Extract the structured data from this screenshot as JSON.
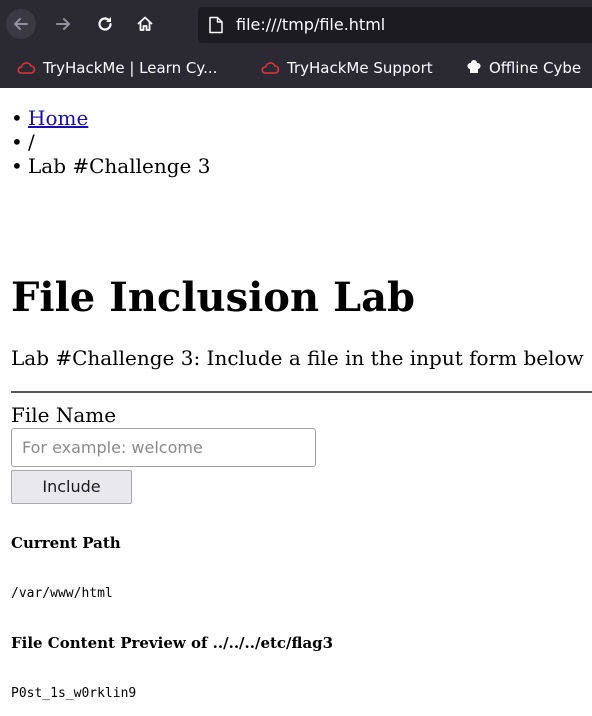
{
  "browser": {
    "url": "file:///tmp/file.html",
    "bookmarks": [
      {
        "label": "TryHackMe | Learn Cy...",
        "icon": "tryhackme-cloud-icon"
      },
      {
        "label": "TryHackMe Support",
        "icon": "tryhackme-cloud-icon"
      },
      {
        "label": "Offline Cybe",
        "icon": "offline-chef-icon"
      }
    ],
    "icon_color": "#ff4f5e"
  },
  "breadcrumb": {
    "items": [
      "Home",
      "/",
      "Lab #Challenge 3"
    ]
  },
  "page": {
    "title": "File Inclusion Lab",
    "description": "Lab #Challenge 3: Include a file in the input form below"
  },
  "form": {
    "label": "File Name",
    "placeholder": "For example: welcome",
    "value": "",
    "button_label": "Include"
  },
  "result": {
    "current_path_heading": "Current Path",
    "current_path": "/var/www/html",
    "preview_heading": "File Content Preview of ../../../etc/flag3",
    "preview_content": "P0st_1s_w0rklin9"
  }
}
